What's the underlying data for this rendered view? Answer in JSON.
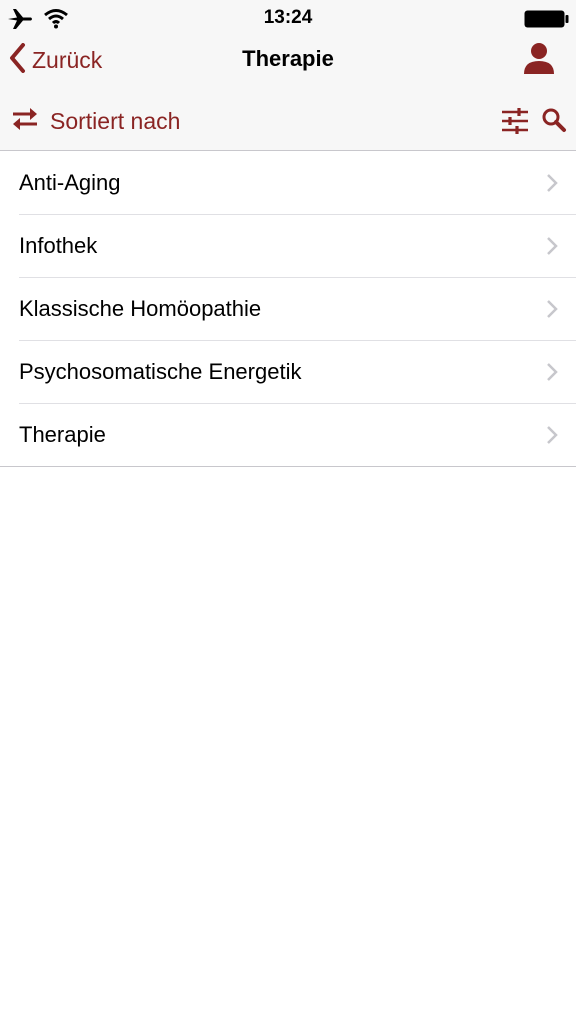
{
  "status_bar": {
    "time": "13:24",
    "icons": [
      "airplane-icon",
      "wifi-icon",
      "battery-icon"
    ]
  },
  "nav": {
    "back_label": "Zurück",
    "title": "Therapie",
    "right_icon": "person-icon"
  },
  "toolbar": {
    "sort_label": "Sortiert nach",
    "sort_icon": "swap-arrows-icon",
    "filter_icon": "sliders-icon",
    "search_icon": "search-icon"
  },
  "list": {
    "items": [
      {
        "label": "Anti-Aging"
      },
      {
        "label": "Infothek"
      },
      {
        "label": "Klassische Homöopathie"
      },
      {
        "label": "Psychosomatische Energetik"
      },
      {
        "label": "Therapie"
      }
    ]
  },
  "colors": {
    "accent": "#8a2423",
    "bar_background": "#f7f7f7",
    "separator": "#c8c7cc",
    "chevron": "#c7c7cc"
  }
}
